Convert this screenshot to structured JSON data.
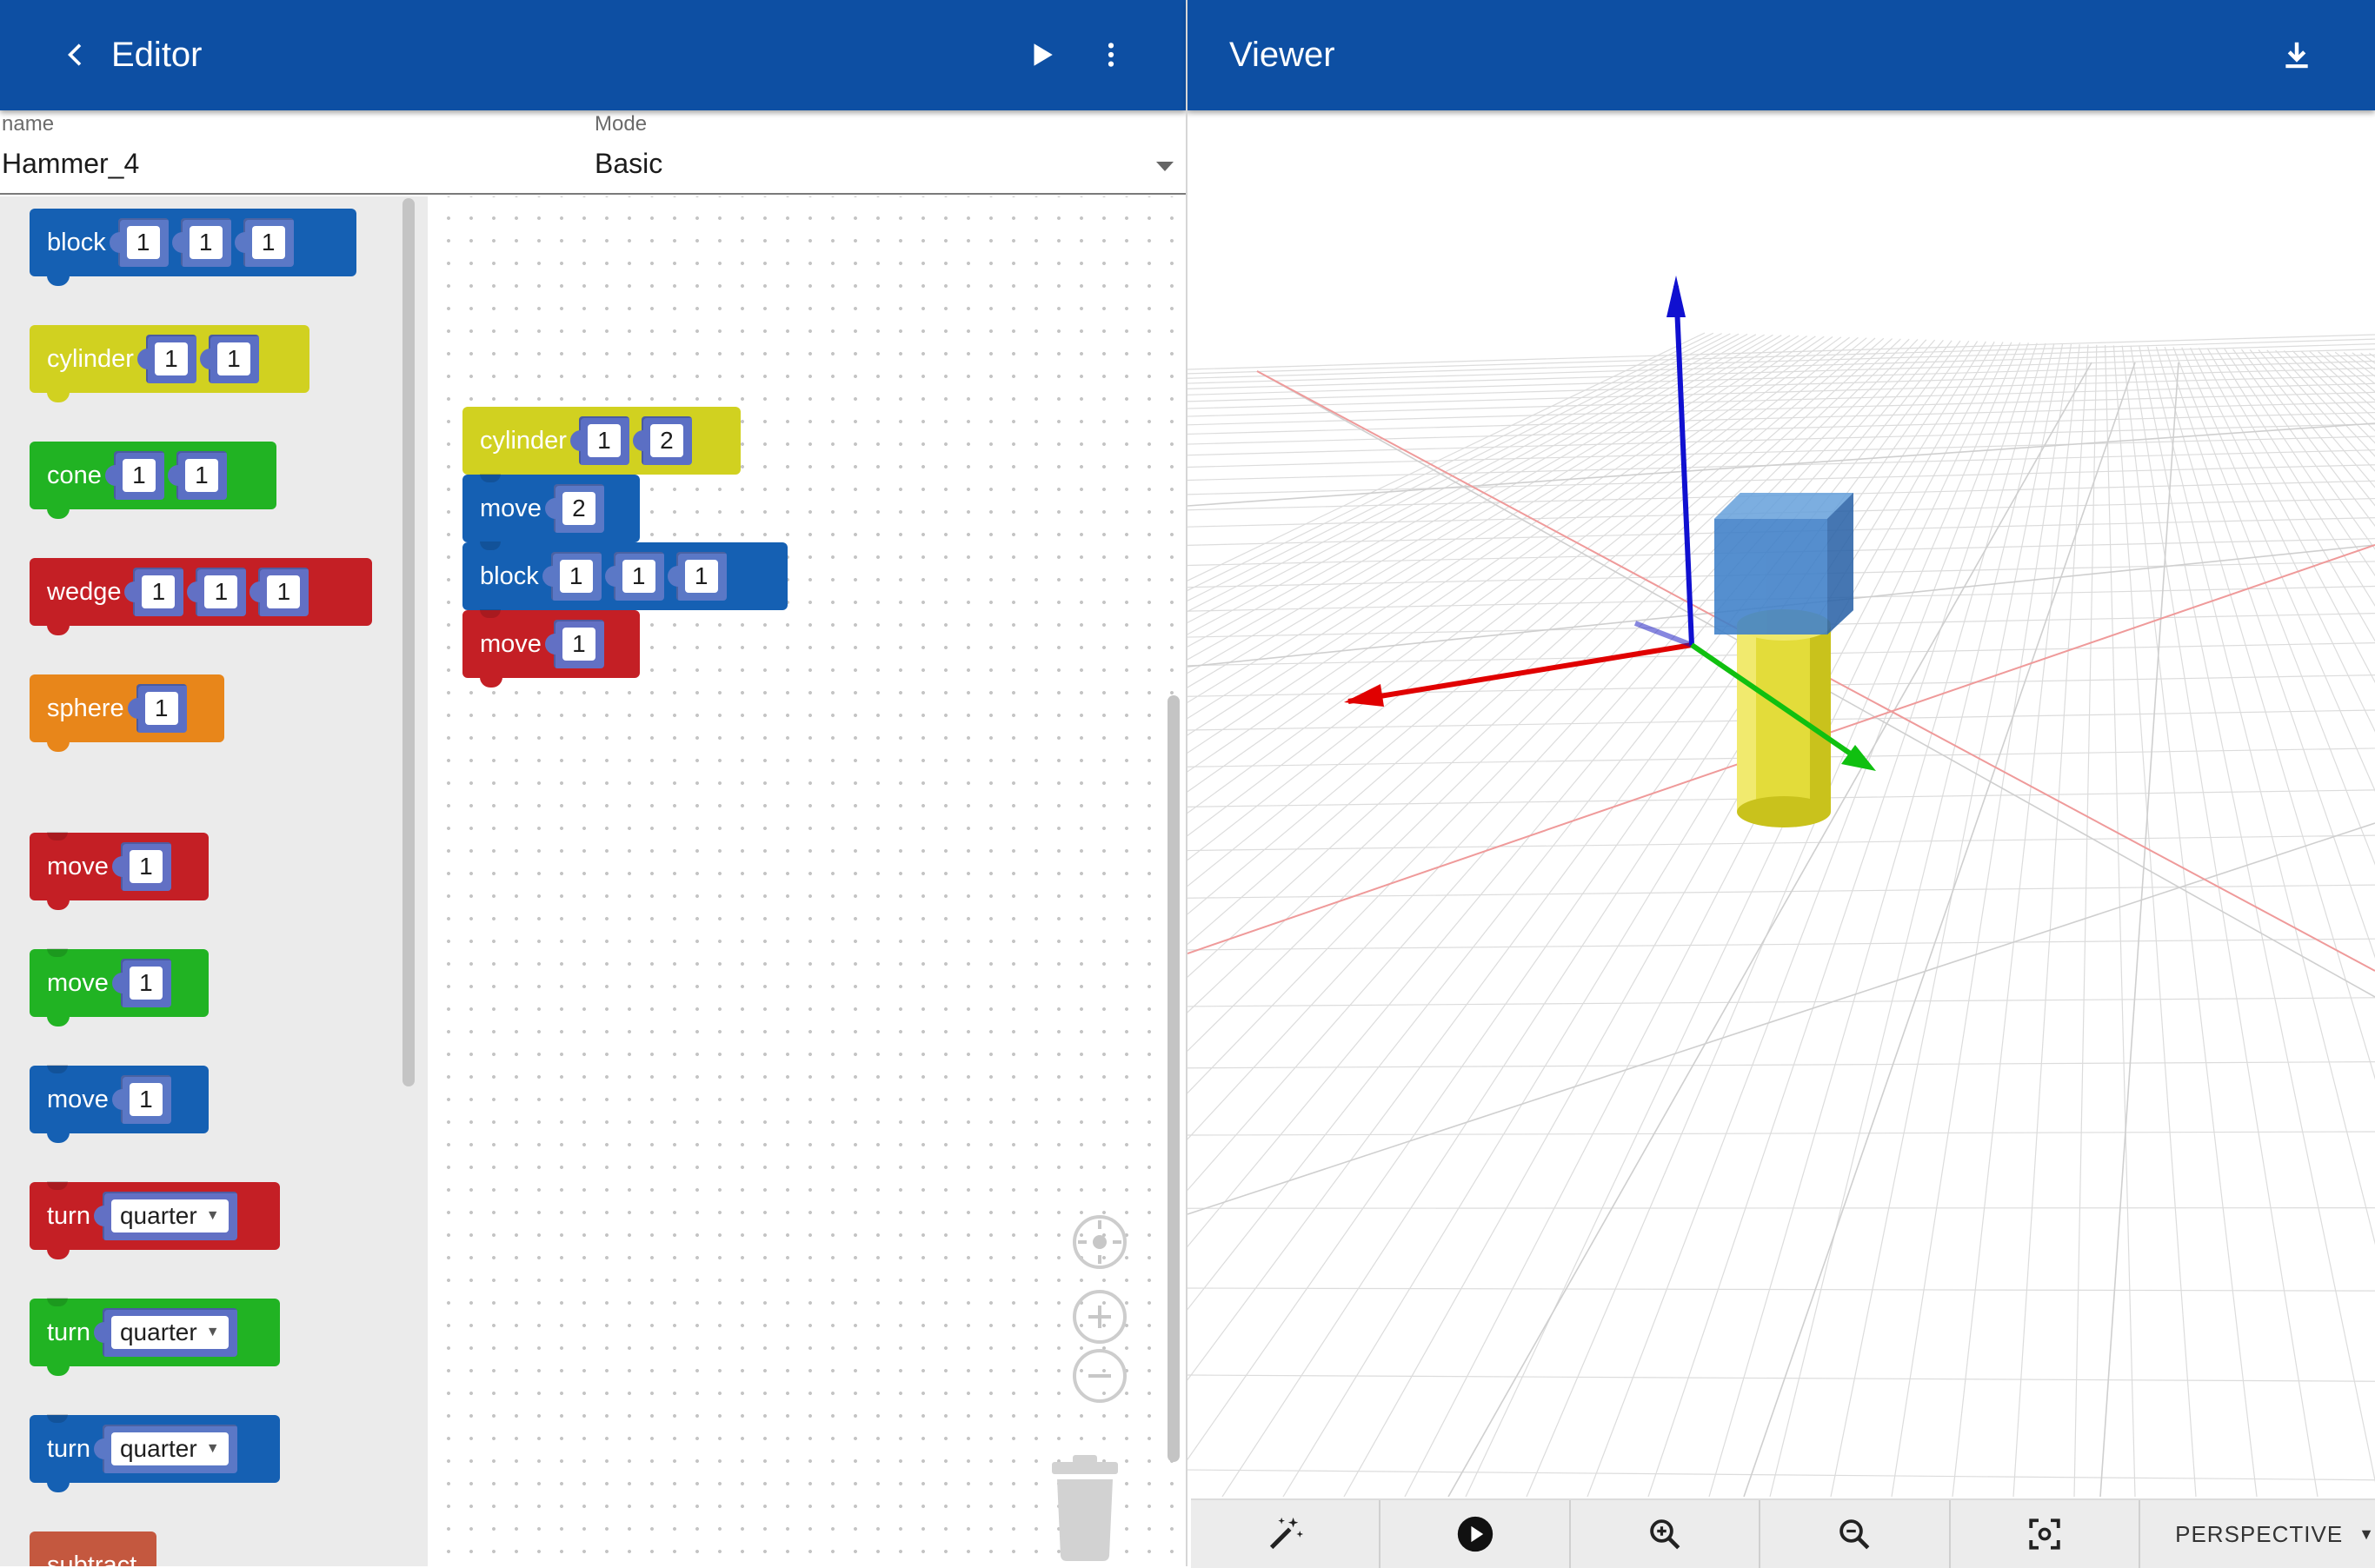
{
  "editor": {
    "title": "Editor",
    "name_label": "name",
    "name_value": "Hammer_4",
    "mode_label": "Mode",
    "mode_value": "Basic"
  },
  "viewer": {
    "title": "Viewer",
    "projection": "PERSPECTIVE"
  },
  "flyout_blocks": [
    {
      "label": "block",
      "color": "#1560b3",
      "inputs": [
        "1",
        "1",
        "1"
      ]
    },
    {
      "label": "cylinder",
      "color": "#d1d120",
      "inputs": [
        "1",
        "1"
      ]
    },
    {
      "label": "cone",
      "color": "#21b323",
      "inputs": [
        "1",
        "1"
      ]
    },
    {
      "label": "wedge",
      "color": "#c41f25",
      "inputs": [
        "1",
        "1",
        "1"
      ]
    },
    {
      "label": "sphere",
      "color": "#e8861a",
      "inputs": [
        "1"
      ]
    },
    {
      "label": "move",
      "color": "#c41f25",
      "inputs": [
        "1"
      ]
    },
    {
      "label": "move",
      "color": "#21b323",
      "inputs": [
        "1"
      ]
    },
    {
      "label": "move",
      "color": "#1560b3",
      "inputs": [
        "1"
      ]
    },
    {
      "label": "turn",
      "color": "#c41f25",
      "inputs": [
        "quarter"
      ]
    },
    {
      "label": "turn",
      "color": "#21b323",
      "inputs": [
        "quarter"
      ]
    },
    {
      "label": "turn",
      "color": "#1560b3",
      "inputs": [
        "quarter"
      ]
    },
    {
      "label": "subtract",
      "color": "#c4583f",
      "inputs": []
    }
  ],
  "workspace_blocks": [
    {
      "label": "cylinder",
      "color": "#d1d120",
      "inputs": [
        "1",
        "2"
      ]
    },
    {
      "label": "move",
      "color": "#1560b3",
      "inputs": [
        "2"
      ]
    },
    {
      "label": "block",
      "color": "#1560b3",
      "inputs": [
        "1",
        "1",
        "1"
      ]
    },
    {
      "label": "move",
      "color": "#c41f25",
      "inputs": [
        "1"
      ]
    }
  ],
  "icons": {
    "back": "chevron-left-icon",
    "run": "play-icon",
    "menu": "more-vert-icon",
    "download": "download-icon",
    "toolbar": [
      "magic-wand-icon",
      "play-circle-icon",
      "zoom-in-icon",
      "zoom-out-icon",
      "center-focus-icon"
    ]
  }
}
